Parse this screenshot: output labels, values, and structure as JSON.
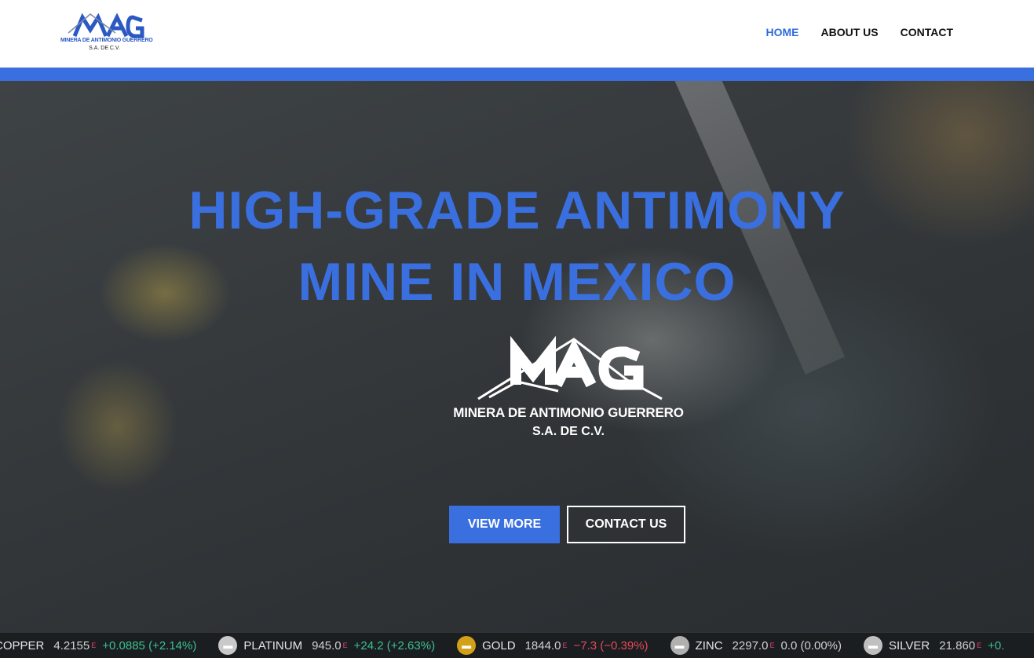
{
  "header": {
    "logo": {
      "mark": "MAG",
      "line1": "MINERA DE ANTIMONIO GUERRERO",
      "line2": "S.A. DE C.V."
    },
    "nav": [
      {
        "label": "HOME",
        "active": true
      },
      {
        "label": "ABOUT US",
        "active": false
      },
      {
        "label": "CONTACT",
        "active": false
      }
    ]
  },
  "hero": {
    "headline_line1": "HIGH-GRADE ANTIMONY",
    "headline_line2": "MINE IN MEXICO",
    "logo": {
      "mark": "MAG",
      "line1": "MINERA DE ANTIMONIO GUERRERO",
      "line2": "S.A. DE C.V."
    },
    "primary_button": "VIEW MORE",
    "secondary_button": "CONTACT US"
  },
  "ticker": [
    {
      "name": "COPPER",
      "price": "4.2155",
      "flag": "E",
      "change": "+0.0885 (+2.14%)",
      "trend": "up",
      "icon": "copper-icon",
      "icon_color": "#b8753a"
    },
    {
      "name": "PLATINUM",
      "price": "945.0",
      "flag": "E",
      "change": "+24.2 (+2.63%)",
      "trend": "up",
      "icon": "platinum-icon",
      "icon_color": "#c9c9c9"
    },
    {
      "name": "GOLD",
      "price": "1844.0",
      "flag": "E",
      "change": "−7.3 (−0.39%)",
      "trend": "down",
      "icon": "gold-icon",
      "icon_color": "#d4a017"
    },
    {
      "name": "ZINC",
      "price": "2297.0",
      "flag": "E",
      "change": "0.0 (0.00%)",
      "trend": "flat",
      "icon": "zinc-icon",
      "icon_color": "#b0b0b0"
    },
    {
      "name": "SILVER",
      "price": "21.860",
      "flag": "E",
      "change": "+0.",
      "trend": "up",
      "icon": "silver-icon",
      "icon_color": "#c0c0c0"
    }
  ],
  "colors": {
    "brand_blue": "#3a6fe0",
    "nav_active": "#2f6be0",
    "ticker_up": "#3cc08c",
    "ticker_down": "#e24a5a"
  }
}
